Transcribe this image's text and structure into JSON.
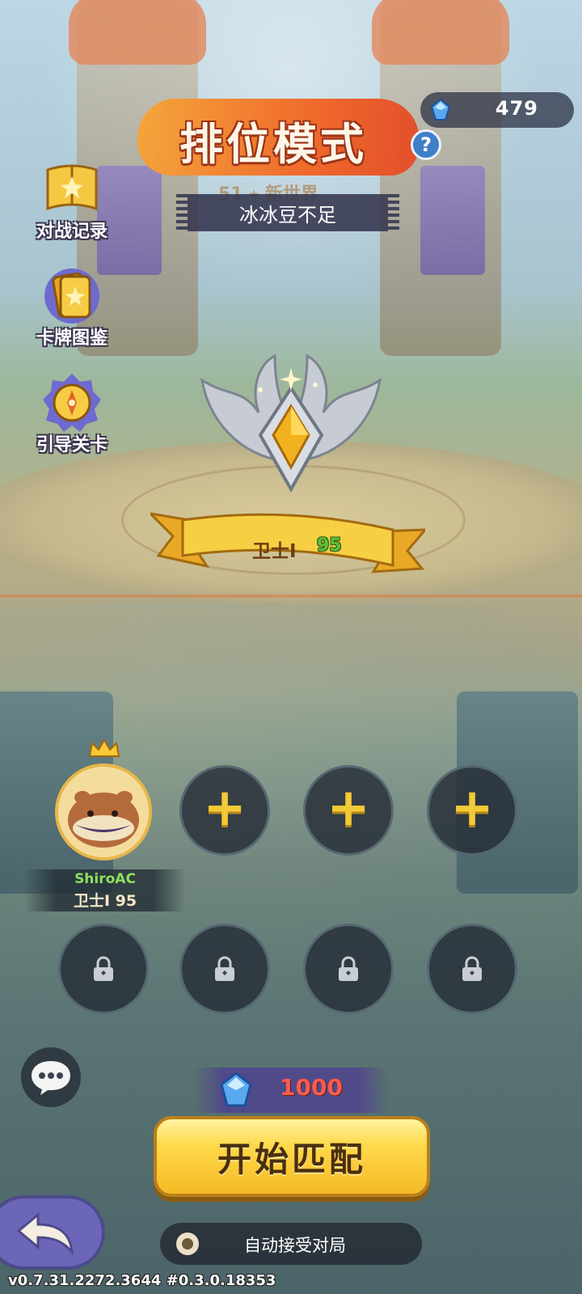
{
  "header": {
    "title": "排位模式",
    "help_label": "?",
    "subtitle_partial": "51 ⭑ 新世界",
    "toast": "冰冰豆不足"
  },
  "currency": {
    "icon": "blue-gem-icon",
    "amount": "479"
  },
  "side_menu": [
    {
      "label": "对战记录",
      "icon": "book-icon"
    },
    {
      "label": "卡牌图鉴",
      "icon": "cards-icon"
    },
    {
      "label": "引导关卡",
      "icon": "compass-icon"
    }
  ],
  "rank": {
    "name": "卫士I",
    "points": "95"
  },
  "party": {
    "player": {
      "name": "ShiroAC",
      "rank": "卫士I 95",
      "icon": "crown-icon"
    },
    "empty_slot_label": "+",
    "locked_icon": "lock-icon"
  },
  "match": {
    "cost": "1000",
    "start_label": "开始匹配",
    "auto_accept_label": "自动接受对局",
    "auto_accept_checked": false
  },
  "version": "v0.7.31.2272.3644 #0.3.0.18353",
  "colors": {
    "accent_orange": "#f06a2c",
    "start_yellow": "#ffd94a",
    "cost_red": "#ff5b4a",
    "player_green": "#8ee05a"
  }
}
